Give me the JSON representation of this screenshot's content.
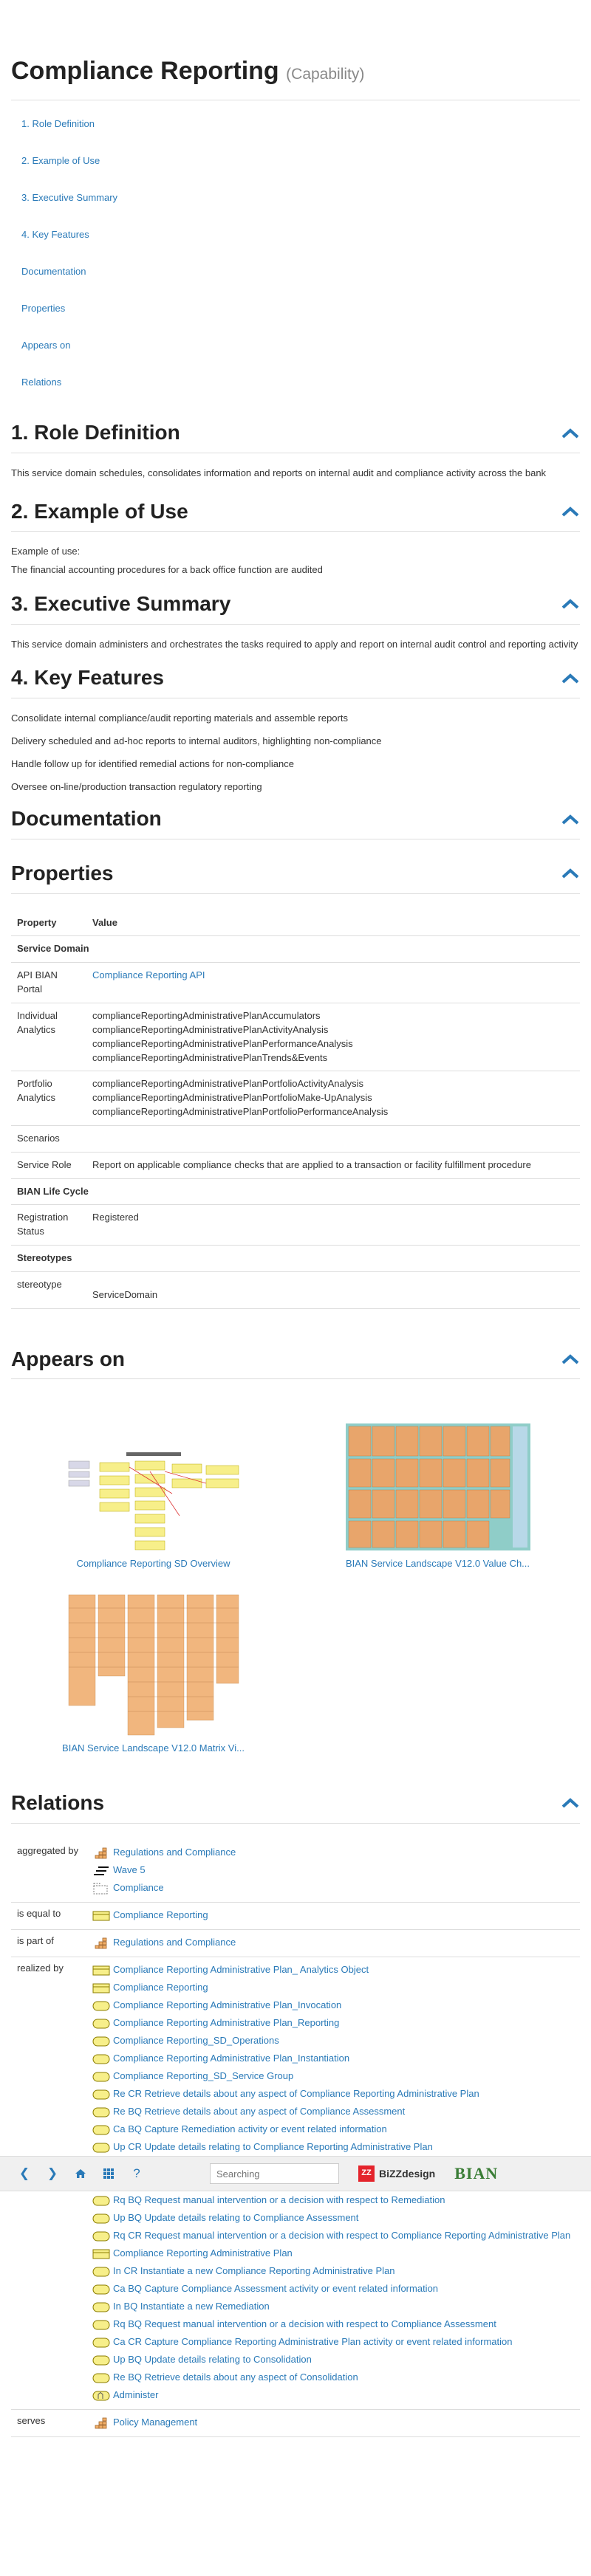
{
  "page": {
    "title": "Compliance Reporting",
    "subtitle": "(Capability)"
  },
  "toc": [
    "1. Role Definition",
    "2. Example of Use",
    "3. Executive Summary",
    "4. Key Features",
    "Documentation",
    "Properties",
    "Appears on",
    "Relations"
  ],
  "sections": {
    "role": {
      "heading": "1. Role Definition",
      "text": "This service domain schedules, consolidates information and reports on internal audit and compliance activity across the bank"
    },
    "example": {
      "heading": "2. Example of Use",
      "label": "Example of use:",
      "text": "The financial accounting procedures for a back office function are audited"
    },
    "summary": {
      "heading": "3. Executive Summary",
      "text": "This service domain administers and orchestrates the tasks required to apply and report on internal audit control and reporting activity"
    },
    "features": {
      "heading": "4. Key Features",
      "items": [
        "Consolidate internal compliance/audit reporting materials and assemble reports",
        "Delivery scheduled and ad-hoc reports to internal auditors, highlighting non-compliance",
        "Handle follow up for identified remedial actions for non-compliance",
        "Oversee on-line/production transaction regulatory reporting"
      ]
    },
    "documentation": {
      "heading": "Documentation"
    },
    "properties": {
      "heading": "Properties",
      "col_property": "Property",
      "col_value": "Value",
      "group_service_domain": "Service Domain",
      "api_portal_label": "API BIAN Portal",
      "api_portal_value": "Compliance Reporting API",
      "individual_label": "Individual Analytics",
      "individual_values": [
        "complianceReportingAdministrativePlanAccumulators",
        "complianceReportingAdministrativePlanActivityAnalysis",
        "complianceReportingAdministrativePlanPerformanceAnalysis",
        "complianceReportingAdministrativePlanTrends&Events"
      ],
      "portfolio_label": "Portfolio Analytics",
      "portfolio_values": [
        "complianceReportingAdministrativePlanPortfolioActivityAnalysis",
        "complianceReportingAdministrativePlanPortfolioMake-UpAnalysis",
        "complianceReportingAdministrativePlanPortfolioPerformanceAnalysis"
      ],
      "scenarios_label": "Scenarios",
      "service_role_label": "Service Role",
      "service_role_value": "Report on applicable compliance checks that are applied to a transaction or facility fulfillment procedure",
      "group_lifecycle": "BIAN Life Cycle",
      "reg_status_label": "Registration Status",
      "reg_status_value": "Registered",
      "group_stereotypes": "Stereotypes",
      "stereotype_label": "stereotype",
      "stereotype_value": "ServiceDomain"
    },
    "appears": {
      "heading": "Appears on",
      "items": [
        "Compliance Reporting SD Overview",
        "BIAN Service Landscape V12.0 Value Ch...",
        "BIAN Service Landscape V12.0 Matrix Vi..."
      ]
    },
    "relations": {
      "heading": "Relations",
      "aggregated_label": "aggregated by",
      "aggregated": [
        {
          "icon": "capability-icon",
          "text": "Regulations and Compliance"
        },
        {
          "icon": "plateau-icon",
          "text": "Wave 5"
        },
        {
          "icon": "grouping-icon",
          "text": "Compliance"
        }
      ],
      "equal_label": "is equal to",
      "equal": [
        {
          "icon": "business-object-icon",
          "text": "Compliance Reporting"
        }
      ],
      "part_label": "is part of",
      "part": [
        {
          "icon": "capability-icon",
          "text": "Regulations and Compliance"
        }
      ],
      "realized_label": "realized by",
      "realized": [
        {
          "icon": "business-object-icon",
          "text": "Compliance Reporting Administrative Plan_ Analytics Object"
        },
        {
          "icon": "business-object-icon",
          "text": "Compliance Reporting"
        },
        {
          "icon": "service-icon",
          "text": "Compliance Reporting Administrative Plan_Invocation"
        },
        {
          "icon": "service-icon",
          "text": "Compliance Reporting Administrative Plan_Reporting"
        },
        {
          "icon": "service-icon",
          "text": "Compliance Reporting_SD_Operations"
        },
        {
          "icon": "service-icon",
          "text": "Compliance Reporting Administrative Plan_Instantiation"
        },
        {
          "icon": "service-icon",
          "text": "Compliance Reporting_SD_Service Group"
        },
        {
          "icon": "service-icon",
          "text": "Re CR Retrieve details about any aspect of Compliance Reporting Administrative Plan"
        },
        {
          "icon": "service-icon",
          "text": "Re BQ Retrieve details about any aspect of Compliance Assessment"
        },
        {
          "icon": "service-icon",
          "text": "Ca BQ Capture Remediation activity or event related information"
        },
        {
          "icon": "service-icon",
          "text": "Up CR Update details relating to Compliance Reporting Administrative Plan"
        },
        {
          "icon": "service-icon",
          "text": "Rq BQ Request manual intervention or a decision with respect to Consolidation"
        },
        {
          "icon": "service-icon",
          "text": "Ca BQ Capture Consolidation activity or event related information"
        },
        {
          "icon": "service-icon",
          "text": "Rq BQ Request manual intervention or a decision with respect to Remediation"
        },
        {
          "icon": "service-icon",
          "text": "Up BQ Update details relating to Compliance Assessment"
        },
        {
          "icon": "service-icon",
          "text": "Rq CR Request manual intervention or a decision with respect to Compliance Reporting Administrative Plan"
        },
        {
          "icon": "business-object-icon",
          "text": "Compliance Reporting Administrative Plan"
        },
        {
          "icon": "service-icon",
          "text": "In CR Instantiate a new Compliance Reporting Administrative Plan"
        },
        {
          "icon": "service-icon",
          "text": "Ca BQ Capture Compliance Assessment activity or event related information"
        },
        {
          "icon": "service-icon",
          "text": "In BQ Instantiate a new Remediation"
        },
        {
          "icon": "service-icon",
          "text": "Rq BQ Request manual intervention or a decision with respect to Compliance Assessment"
        },
        {
          "icon": "service-icon",
          "text": "Ca CR Capture Compliance Reporting Administrative Plan activity or event related information"
        },
        {
          "icon": "service-icon",
          "text": "Up BQ Update details relating to Consolidation"
        },
        {
          "icon": "service-icon",
          "text": "Re BQ Retrieve details about any aspect of Consolidation"
        },
        {
          "icon": "function-icon",
          "text": "Administer"
        }
      ],
      "serves_label": "serves",
      "serves": [
        {
          "icon": "capability-icon",
          "text": "Policy Management"
        }
      ]
    }
  },
  "toolbar": {
    "search_placeholder": "Searching",
    "bizzdesign_label": "BiZZdesign",
    "bian_label": "BIAN"
  },
  "colors": {
    "link": "#2a7ab8",
    "chevron": "#2a7ab8"
  }
}
